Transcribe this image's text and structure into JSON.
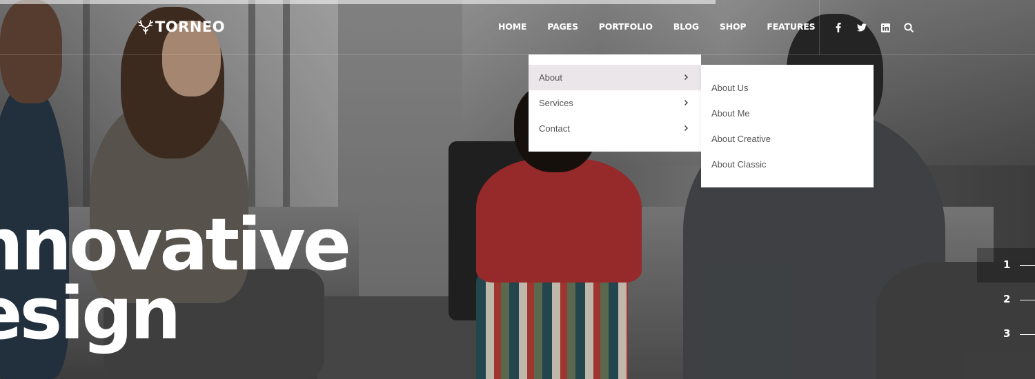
{
  "brand": {
    "name": "TORNEO",
    "logo_icon": "stag-antler-icon"
  },
  "nav": {
    "items": [
      "HOME",
      "PAGES",
      "PORTFOLIO",
      "BLOG",
      "SHOP",
      "FEATURES"
    ],
    "active": "PAGES"
  },
  "social": {
    "icons": [
      "facebook-icon",
      "twitter-icon",
      "linkedin-icon",
      "search-icon"
    ]
  },
  "dropdown": {
    "items": [
      {
        "label": "About",
        "has_submenu": true,
        "active": true
      },
      {
        "label": "Services",
        "has_submenu": true,
        "active": false
      },
      {
        "label": "Contact",
        "has_submenu": true,
        "active": false
      }
    ]
  },
  "submenu": {
    "items": [
      "About Us",
      "About Me",
      "About Creative",
      "About Classic"
    ]
  },
  "hero": {
    "line1": "nnovative",
    "line2": "esign"
  },
  "slides": {
    "numbers": [
      "1",
      "2",
      "3"
    ],
    "active": "1"
  },
  "colors": {
    "text_light": "#ffffff",
    "menu_text": "#555555",
    "menu_active_bg": "#ebe6e9",
    "menu_bg": "#ffffff"
  }
}
